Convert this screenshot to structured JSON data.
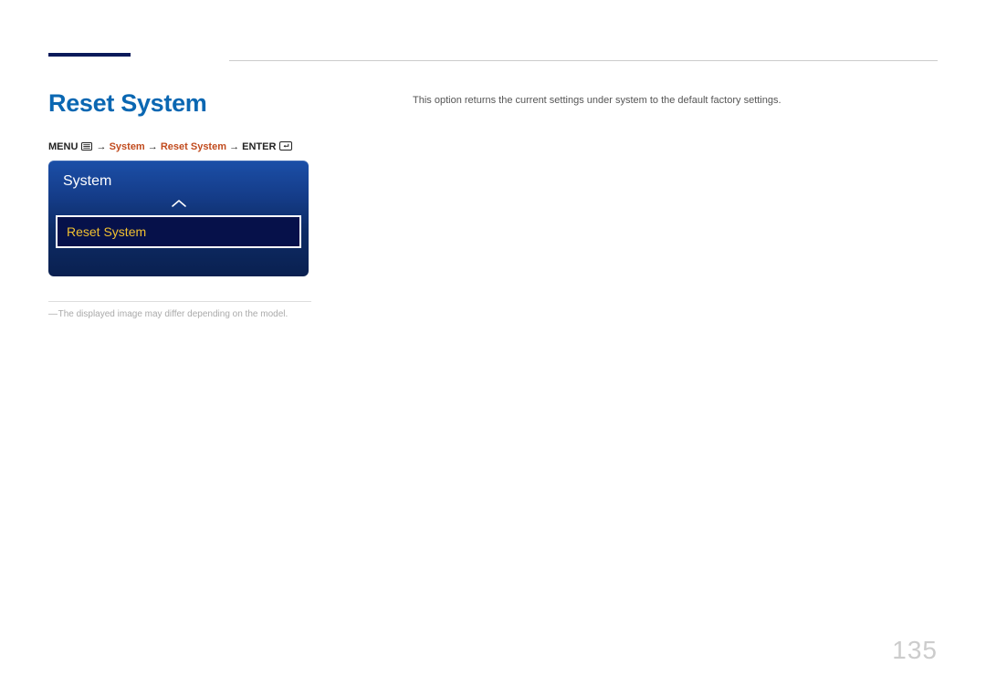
{
  "title": "Reset System",
  "breadcrumb": {
    "menu": "MENU",
    "arrow": "→",
    "system": "System",
    "reset_system": "Reset System",
    "enter": "ENTER"
  },
  "menu": {
    "header": "System",
    "item": "Reset System"
  },
  "note": {
    "dash": "―",
    "text": "The displayed image may differ depending on the model."
  },
  "description": "This option returns the current settings under system to the default factory settings.",
  "page_number": "135"
}
